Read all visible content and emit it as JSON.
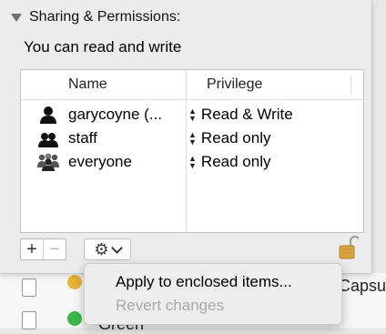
{
  "section": {
    "title": "Sharing & Permissions:",
    "access_text": "You can read and write"
  },
  "table": {
    "columns": [
      "Name",
      "Privilege"
    ],
    "rows": [
      {
        "name": "garycoyne (...",
        "privilege": "Read & Write",
        "icon": "single-user-icon"
      },
      {
        "name": "staff",
        "privilege": "Read only",
        "icon": "group-icon"
      },
      {
        "name": "everyone",
        "privilege": "Read only",
        "icon": "everyone-icon"
      }
    ]
  },
  "controls": {
    "add_label": "+",
    "remove_label": "−",
    "action_icon": "gear-icon",
    "lock_icon": "lock-icon"
  },
  "menu": {
    "items": [
      {
        "label": "Apply to enclosed items...",
        "enabled": true
      },
      {
        "label": "Revert changes",
        "enabled": false
      }
    ]
  },
  "background": {
    "partial_label_1": "Capsu",
    "partial_label_2": "Green"
  },
  "colors": {
    "accent_yellow": "#e8b33a",
    "accent_green": "#3fb64a",
    "disabled_text": "#a9a9a9"
  }
}
